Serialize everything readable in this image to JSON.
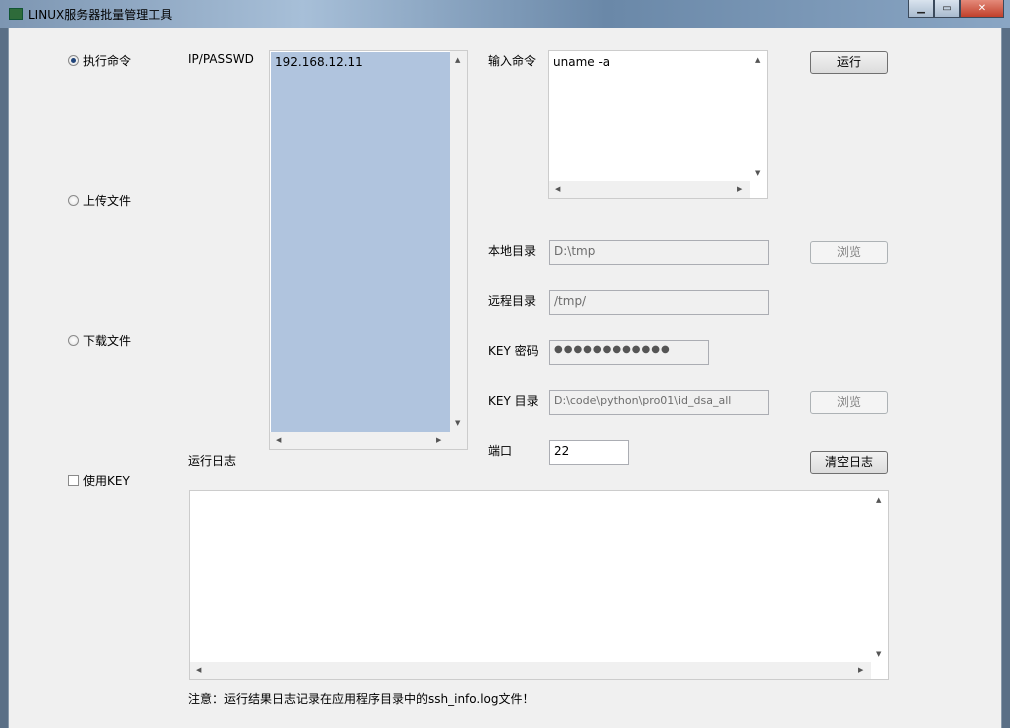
{
  "window": {
    "title": "LINUX服务器批量管理工具"
  },
  "modes": [
    {
      "label": "执行命令",
      "selected": true
    },
    {
      "label": "上传文件",
      "selected": false
    },
    {
      "label": "下载文件",
      "selected": false
    }
  ],
  "use_key": {
    "label": "使用KEY",
    "checked": false
  },
  "hosts": {
    "label": "IP/PASSWD",
    "items": [
      "192.168.12.11"
    ]
  },
  "command": {
    "label": "输入命令",
    "value": "uname -a"
  },
  "run_button": "运行",
  "local_dir": {
    "label": "本地目录",
    "value": "D:\\tmp",
    "browse": "浏览"
  },
  "remote_dir": {
    "label": "远程目录",
    "value": "/tmp/"
  },
  "key_password": {
    "label": "KEY 密码",
    "value": "●●●●●●●●●●●●"
  },
  "key_dir": {
    "label": "KEY 目录",
    "value": "D:\\code\\python\\pro01\\id_dsa_all",
    "browse": "浏览"
  },
  "port": {
    "label": "端口",
    "value": "22"
  },
  "log": {
    "label": "运行日志",
    "clear_button": "清空日志",
    "content": ""
  },
  "note": "注意：运行结果日志记录在应用程序目录中的ssh_info.log文件！",
  "colors": {
    "host_list_bg": "#b0c4de",
    "window_bg": "#f0f0f0"
  }
}
